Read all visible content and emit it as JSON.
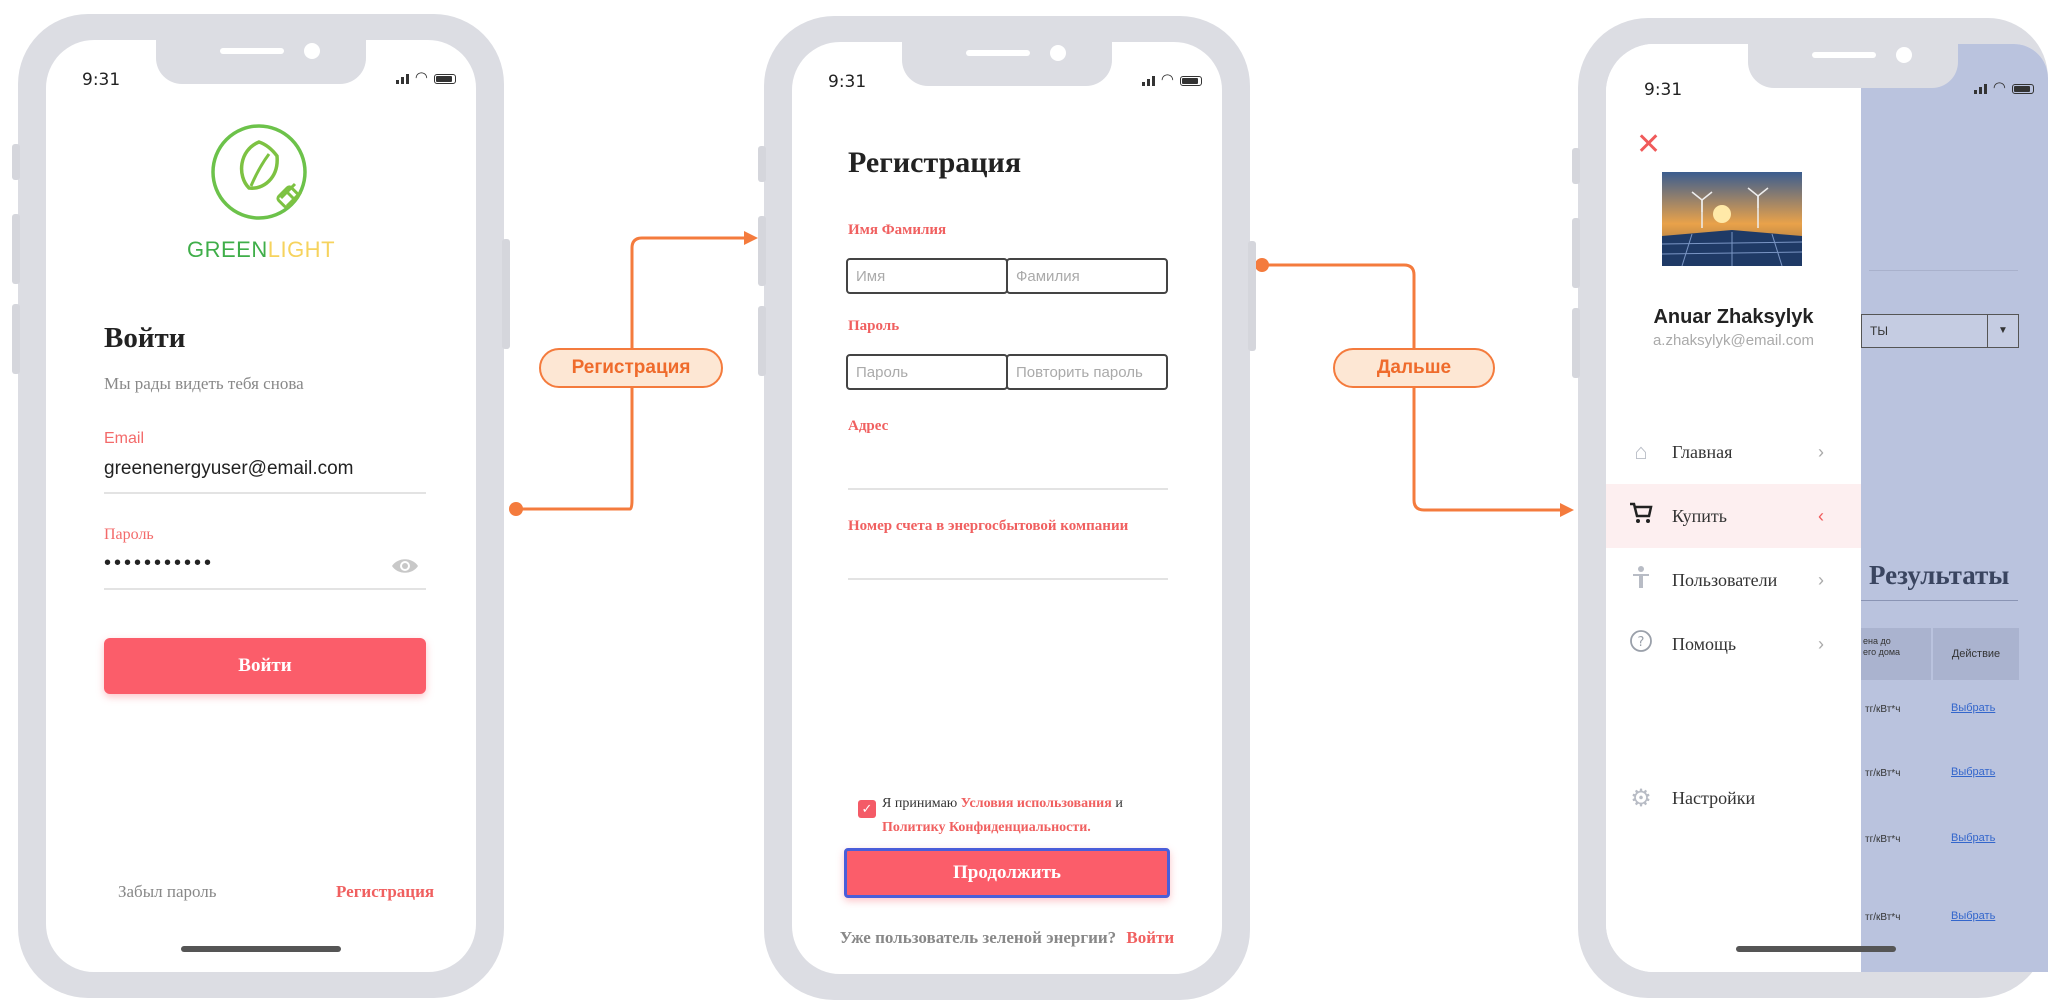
{
  "status_bar": {
    "time": "9:31"
  },
  "connectors": {
    "register_label": "Регистрация",
    "next_label": "Дальше"
  },
  "login": {
    "brand_green": "GREEN",
    "brand_light": "LIGHT",
    "title": "Войти",
    "subtitle": "Мы рады видеть тебя снова",
    "email_label": "Email",
    "email_value": "greenenergyuser@email.com",
    "password_label": "Пароль",
    "password_value": "•••••••••••",
    "submit": "Войти",
    "forgot": "Забыл пароль",
    "register": "Регистрация"
  },
  "register": {
    "title": "Регистрация",
    "name_label": "Имя Фамилия",
    "first_placeholder": "Имя",
    "last_placeholder": "Фамилия",
    "password_label": "Пароль",
    "password_placeholder": "Пароль",
    "repeat_placeholder": "Повторить пароль",
    "address_label": "Адрес",
    "account_label": "Номер счета в энергосбытовой компании",
    "terms_pre": "Я принимаю ",
    "terms_link": "Условия использования",
    "terms_and": " и",
    "privacy_link": "Политику Конфиденциальности.",
    "continue": "Продолжить",
    "existing": "Уже пользователь зеленой энергии?",
    "login_link": "Войти"
  },
  "drawer": {
    "user_name": "Anuar Zhaksylyk",
    "user_email": "a.zhaksylyk@email.com",
    "items": [
      {
        "label": "Главная",
        "icon": "home-icon"
      },
      {
        "label": "Купить",
        "icon": "cart-icon",
        "active": true
      },
      {
        "label": "Пользователи",
        "icon": "person-icon"
      },
      {
        "label": "Помощь",
        "icon": "help-icon"
      }
    ],
    "settings": "Настройки"
  },
  "background": {
    "select_partial": "ТЫ",
    "results_title": "Результаты",
    "col_price": "ена до\nего дома",
    "col_action": "Действие",
    "rows": [
      {
        "price": "тг/кВт*ч",
        "action": "Выбрать"
      },
      {
        "price": "тг/кВт*ч",
        "action": "Выбрать"
      },
      {
        "price": "тг/кВт*ч",
        "action": "Выбрать"
      },
      {
        "price": "тг/кВт*ч",
        "action": "Выбрать"
      }
    ]
  },
  "colors": {
    "accent": "#fb5d6a",
    "connector": "#f47b3d",
    "overlay": "#bac3de"
  }
}
